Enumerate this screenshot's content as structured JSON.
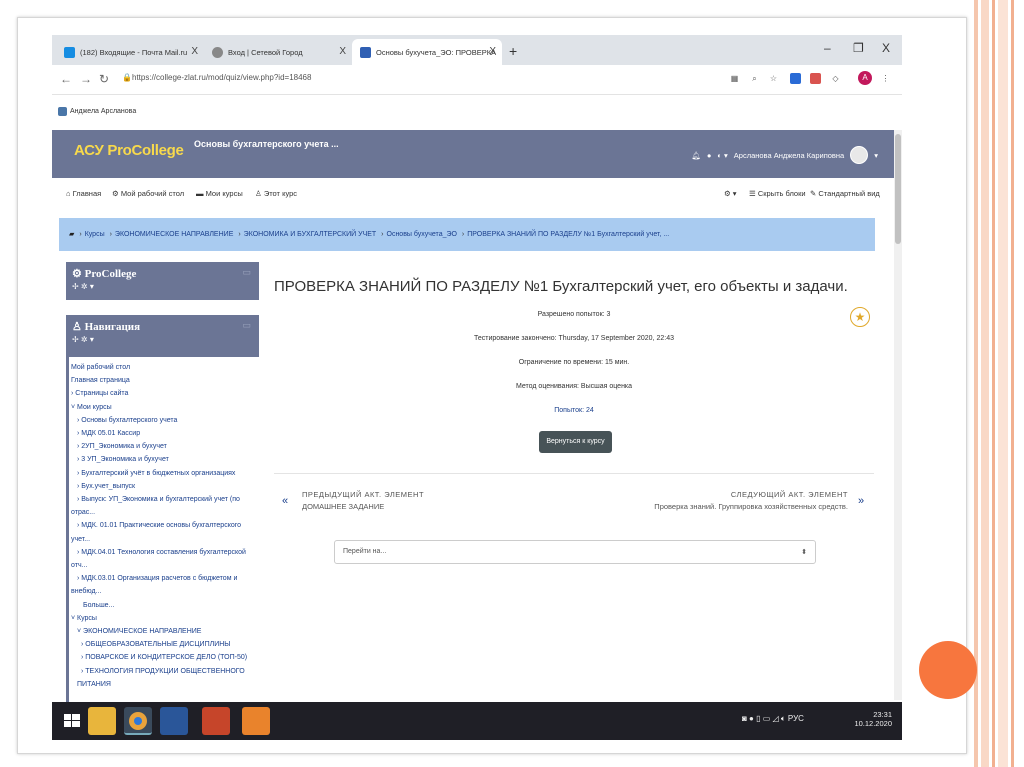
{
  "browser": {
    "tabs": [
      {
        "label": "(182) Входящие - Почта Mail.ru",
        "close": "X"
      },
      {
        "label": "Вход | Сетевой Город",
        "close": "X"
      },
      {
        "label": "Основы бухучета_ЭО: ПРОВЕРКА",
        "close": "X"
      }
    ],
    "new_tab": "+",
    "window_controls": {
      "minimize": "–",
      "maximize": "❐",
      "close": "X"
    },
    "url": "https://college-zlat.ru/mod/quiz/view.php?id=18468",
    "bookmark": "Анджела Арсланова"
  },
  "site": {
    "brand": "АСУ ProCollege",
    "course_title": "Основы бухгалтерского учета ...",
    "user_name": "Арсланова Анджела Кариповна",
    "nav": {
      "home": "Главная",
      "dashboard": "Мой рабочий стол",
      "my_courses": "Мои курсы",
      "this_course": "Этот курс",
      "hide_blocks": "Скрыть блоки",
      "standard_view": "Стандартный вид"
    },
    "breadcrumb": [
      "Курсы",
      "ЭКОНОМИЧЕСКОЕ НАПРАВЛЕНИЕ",
      "ЭКОНОМИКА И БУХГАЛТЕРСКИЙ УЧЕТ",
      "Основы бухучета_ЭО",
      "ПРОВЕРКА ЗНАНИЙ ПО РАЗДЕЛУ №1 Бухгалтерский учет, ..."
    ]
  },
  "blocks": {
    "procollege_title": "ProCollege",
    "navigation_title": "Навигация",
    "controls": "✢ ✲ ▾",
    "minimize": "▭"
  },
  "navigation": [
    {
      "label": "Мой рабочий стол",
      "level": 0
    },
    {
      "label": "Главная страница",
      "level": 0
    },
    {
      "label": "› Страницы сайта",
      "level": 0
    },
    {
      "label": "˅ Мои курсы",
      "level": 0
    },
    {
      "label": "› Основы бухгалтерского учета",
      "level": 1
    },
    {
      "label": "› МДК 05.01 Кассир",
      "level": 1
    },
    {
      "label": "› 2УП_Экономика и бухучет",
      "level": 1
    },
    {
      "label": "› 3 УП_Экономика и бухучет",
      "level": 1
    },
    {
      "label": "› Бухгалтерский учёт в бюджетных организациях",
      "level": 1
    },
    {
      "label": "› Бух.учет_выпуск",
      "level": 1
    },
    {
      "label": "› Выпуск: УП_Экономика и бухгалтерский учет (по",
      "level": 1
    },
    {
      "label": "отрас...",
      "level": 0
    },
    {
      "label": "› МДК. 01.01 Практические основы бухгалтерского",
      "level": 1
    },
    {
      "label": "учет...",
      "level": 0
    },
    {
      "label": "› МДК.04.01 Технология составления бухгалтерской",
      "level": 1
    },
    {
      "label": "отч...",
      "level": 0
    },
    {
      "label": "› МДК.03.01 Организация расчетов с бюджетом и",
      "level": 1
    },
    {
      "label": "внебюд...",
      "level": 0
    },
    {
      "label": "Больше...",
      "level": 3
    },
    {
      "label": "˅ Курсы",
      "level": 0
    },
    {
      "label": "˅ ЭКОНОМИЧЕСКОЕ НАПРАВЛЕНИЕ",
      "level": 1
    },
    {
      "label": "› ОБЩЕОБРАЗОВАТЕЛЬНЫЕ ДИСЦИПЛИНЫ",
      "level": 2
    },
    {
      "label": "› ПОВАРСКОЕ И КОНДИТЕРСКОЕ ДЕЛО (ТОП-50)",
      "level": 2
    },
    {
      "label": "› ТЕХНОЛОГИЯ ПРОДУКЦИИ ОБЩЕСТВЕННОГО",
      "level": 2
    },
    {
      "label": "ПИТАНИЯ",
      "level": 1
    }
  ],
  "quiz": {
    "title": "ПРОВЕРКА ЗНАНИЙ ПО РАЗДЕЛУ №1 Бухгалтерский учет, его объекты и задачи.",
    "attempts_allowed": "Разрешено попыток: 3",
    "closed": "Тестирование закончено: Thursday, 17 September 2020, 22:43",
    "time_limit": "Ограничение по времени: 15 мин.",
    "grading_method": "Метод оценивания: Высшая оценка",
    "attempts_link": "Попыток: 24",
    "back_button": "Вернуться к курсу",
    "prev_caption": "ПРЕДЫДУЩИЙ АКТ. ЭЛЕМЕНТ",
    "prev_name": "ДОМАШНЕЕ ЗАДАНИЕ",
    "next_caption": "СЛЕДУЮЩИЙ АКТ. ЭЛЕМЕНТ",
    "next_name": "Проверка знаний. Группировка хозяйственных средств.",
    "jump_placeholder": "Перейти на..."
  },
  "taskbar": {
    "lang": "РУС",
    "time": "23:31",
    "date": "10.12.2020"
  },
  "colors": {
    "header": "#6b7595",
    "brand": "#f7d94c",
    "breadcrumb": "#a9cbf0",
    "accent_circle": "#f7763e"
  }
}
